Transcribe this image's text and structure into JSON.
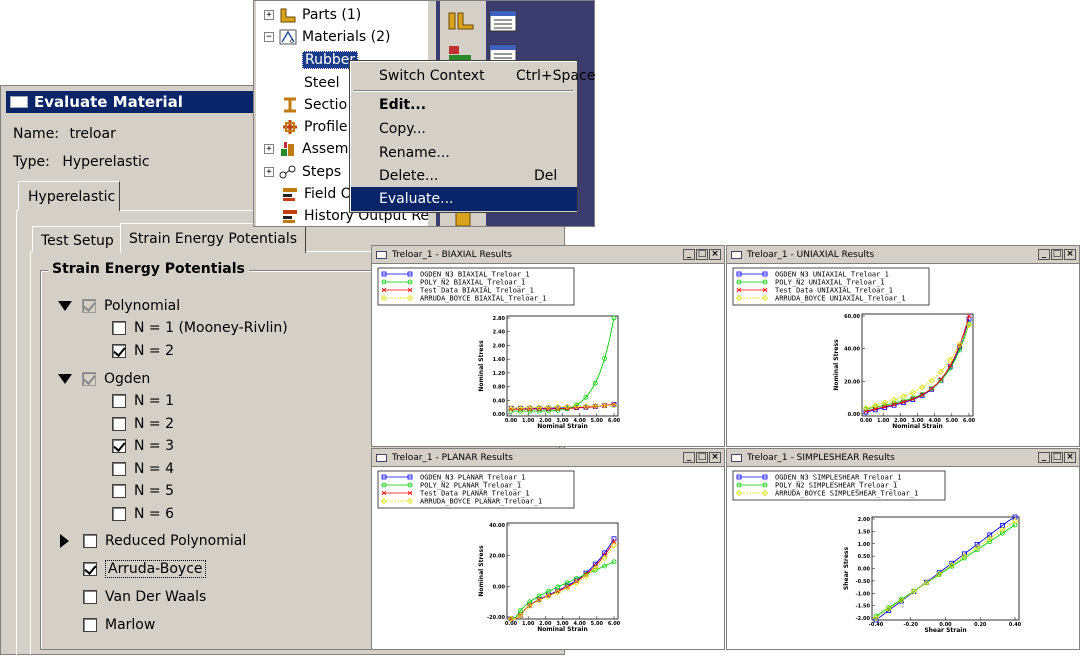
{
  "tree": {
    "items": [
      {
        "label": "Parts (1)",
        "expander": "+"
      },
      {
        "label": "Materials (2)",
        "expander": "−"
      },
      {
        "label": "Rubber"
      },
      {
        "label": "Steel"
      },
      {
        "label": "Sectio"
      },
      {
        "label": "Profile"
      },
      {
        "label": "Assem",
        "expander": "+"
      },
      {
        "label": "Steps",
        "expander": "+"
      },
      {
        "label": "Field O"
      },
      {
        "label": "History Output Re"
      }
    ]
  },
  "context_menu": {
    "items": [
      {
        "label": "Switch Context",
        "shortcut": "Ctrl+Space"
      },
      {
        "label": "Edit..."
      },
      {
        "label": "Copy..."
      },
      {
        "label": "Rename..."
      },
      {
        "label": "Delete...",
        "shortcut": "Del"
      },
      {
        "label": "Evaluate..."
      }
    ]
  },
  "dialog": {
    "title": "Evaluate Material",
    "name_label": "Name:",
    "name_value": "treloar",
    "type_label": "Type:",
    "type_value": "Hyperelastic",
    "outer_tab": "Hyperelastic",
    "inner_tabs": [
      "Test Setup",
      "Strain Energy Potentials"
    ],
    "group_title": "Strain Energy Potentials",
    "polynomial": {
      "label": "Polynomial",
      "options": [
        {
          "label": "N = 1 (Mooney-Rivlin)",
          "checked": false
        },
        {
          "label": "N = 2",
          "checked": true
        }
      ]
    },
    "ogden": {
      "label": "Ogden",
      "options": [
        {
          "label": "N = 1",
          "checked": false
        },
        {
          "label": "N = 2",
          "checked": false
        },
        {
          "label": "N = 3",
          "checked": true
        },
        {
          "label": "N = 4",
          "checked": false
        },
        {
          "label": "N = 5",
          "checked": false
        },
        {
          "label": "N = 6",
          "checked": false
        }
      ]
    },
    "others": [
      {
        "label": "Reduced Polynomial",
        "checked": false,
        "expandable": true
      },
      {
        "label": "Arruda-Boyce",
        "checked": true,
        "focused": true
      },
      {
        "label": "Van Der Waals",
        "checked": false
      },
      {
        "label": "Marlow",
        "checked": false
      }
    ]
  },
  "colors": {
    "ogden": "#0000ff",
    "poly": "#00cc00",
    "test": "#ff0000",
    "arruda": "#dddd00"
  },
  "windows": [
    {
      "title": "Treloar_1 - BIAXIAL Results",
      "legend": [
        "OGDEN_N3 BIAXIAL_Treloar_1",
        "POLY_N2 BIAXIAL_Treloar_1",
        "Test Data BIAXIAL_Treloar_1",
        "ARRUDA_BOYCE BIAXIAL_Treloar_1"
      ],
      "ylabel": "Nominal Stress",
      "xlabel": "Nominal Strain",
      "xticks": [
        "0.00",
        "1.00",
        "2.00",
        "3.00",
        "4.00",
        "5.00",
        "6.00"
      ],
      "yticks": [
        "0.00",
        "0.40",
        "0.80",
        "1.20",
        "1.60",
        "2.00",
        "2.40",
        "2.80"
      ]
    },
    {
      "title": "Treloar_1 - UNIAXIAL Results",
      "legend": [
        "OGDEN_N3 UNIAXIAL_Treloar_1",
        "POLY_N2 UNIAXIAL_Treloar_1",
        "Test Data UNIAXIAL_Treloar_1",
        "ARRUDA_BOYCE UNIAXIAL_Treloar_1"
      ],
      "ylabel": "Nominal Stress",
      "xlabel": "Nominal Strain",
      "xticks": [
        "0.00",
        "1.00",
        "2.00",
        "3.00",
        "4.00",
        "5.00",
        "6.00"
      ],
      "yticks": [
        "0.00",
        "20.00",
        "40.00",
        "60.00"
      ]
    },
    {
      "title": "Treloar_1 - PLANAR Results",
      "legend": [
        "OGDEN_N3 PLANAR_Treloar_1",
        "POLY_N2 PLANAR_Treloar_1",
        "Test Data PLANAR_Treloar_1",
        "ARRUDA_BOYCE PLANAR_Treloar_1"
      ],
      "ylabel": "Nominal Stress",
      "xlabel": "Nominal Strain",
      "xticks": [
        "0.00",
        "1.00",
        "2.00",
        "3.00",
        "4.00",
        "5.00",
        "6.00"
      ],
      "yticks": [
        "-20.00",
        "0.00",
        "20.00",
        "40.00"
      ]
    },
    {
      "title": "Treloar_1 - SIMPLESHEAR Results",
      "legend": [
        "OGDEN_N3 SIMPLESHEAR_Treloar_1",
        "POLY_N2 SIMPLESHEAR_Treloar_1",
        "ARRUDA_BOYCE SIMPLESHEAR_Treloar_1"
      ],
      "ylabel": "Shear Stress",
      "xlabel": "Shear Strain",
      "xticks": [
        "-0.40",
        "-0.20",
        "0.00",
        "0.20",
        "0.40"
      ],
      "yticks": [
        "-2.00",
        "-1.50",
        "-1.00",
        "-0.50",
        "0.00",
        "0.50",
        "1.00",
        "1.50",
        "2.00"
      ]
    }
  ]
}
